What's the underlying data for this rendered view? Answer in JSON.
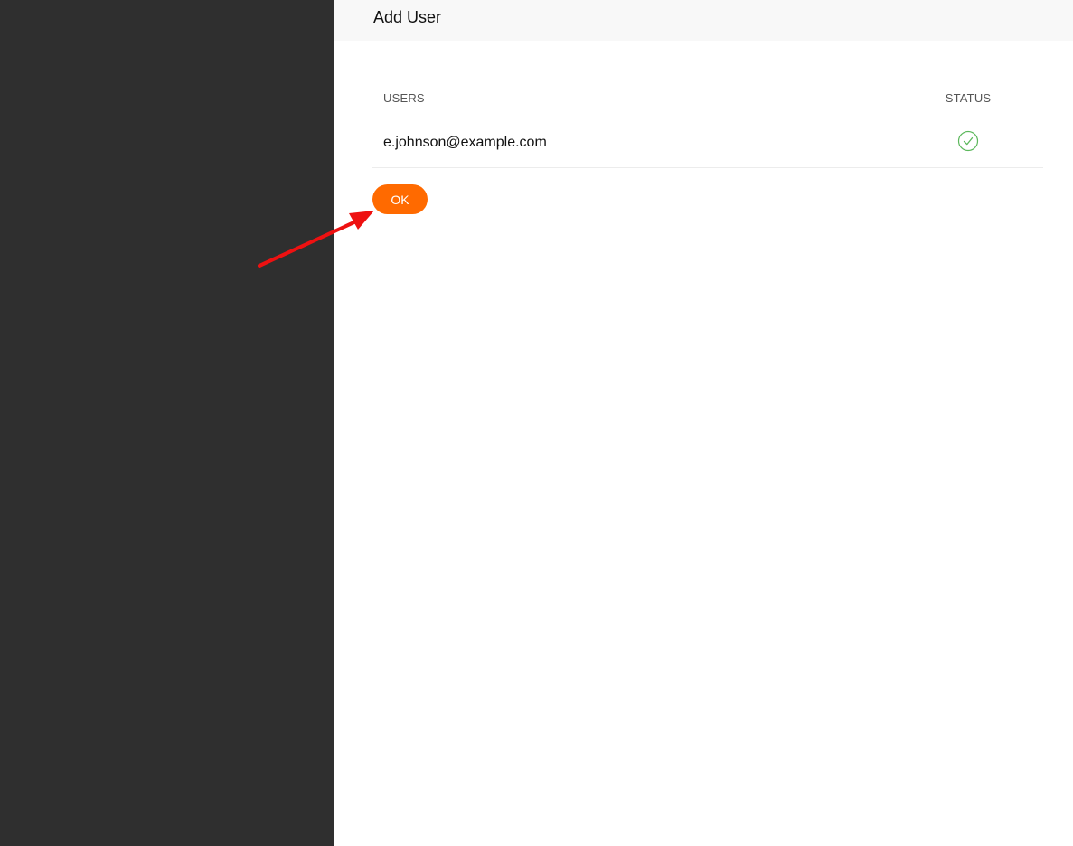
{
  "panel": {
    "title": "Add User"
  },
  "table": {
    "columns": {
      "users": "USERS",
      "status": "STATUS"
    },
    "rows": [
      {
        "user": "e.johnson@example.com",
        "status_icon": "check-circle-icon",
        "status_color": "#5cb85c"
      }
    ]
  },
  "actions": {
    "ok_label": "OK"
  },
  "colors": {
    "accent": "#ff6a00",
    "overlay": "#2f2f2f",
    "annotation_arrow": "#ee1111"
  }
}
